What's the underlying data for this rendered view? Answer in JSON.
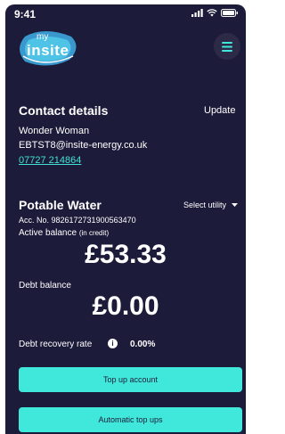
{
  "status_bar": {
    "time": "9:41"
  },
  "logo": {
    "small": "my",
    "main": "insite"
  },
  "contact": {
    "title": "Contact details",
    "update_label": "Update",
    "name": "Wonder Woman",
    "email": "EBTST8@insite-energy.co.uk",
    "phone": "07727 214864"
  },
  "utility": {
    "title": "Potable Water",
    "select_label": "Select utility",
    "account_number": "Acc. No. 9826172731900563470",
    "active_balance_label": "Active balance",
    "active_balance_note": "(in credit)",
    "active_balance_value": "£53.33",
    "debt_balance_label": "Debt balance",
    "debt_balance_value": "£0.00",
    "debt_recovery_label": "Debt recovery rate",
    "debt_recovery_value": "0.00%"
  },
  "actions": {
    "top_up_label": "Top up account",
    "auto_top_up_label": "Automatic top ups"
  },
  "colors": {
    "background": "#1d1b3a",
    "accent": "#3fe8da"
  }
}
